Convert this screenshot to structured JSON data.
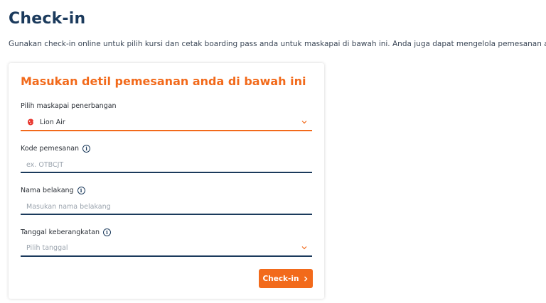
{
  "header": {
    "title": "Check-in",
    "description": "Gunakan check-in online untuk pilih kursi dan cetak boarding pass anda untuk maskapai di bawah ini. Anda juga dapat mengelola pemesanan anda."
  },
  "form": {
    "title": "Masukan detil pemesanan anda di bawah ini",
    "airline": {
      "label": "Pilih maskapai penerbangan",
      "selected_value": "Lion Air",
      "icon": "lion-air-logo"
    },
    "booking_code": {
      "label": "Kode pemesanan",
      "placeholder": "ex. OTBCJT",
      "value": ""
    },
    "last_name": {
      "label": "Nama belakang",
      "placeholder": "Masukan nama belakang",
      "value": ""
    },
    "departure_date": {
      "label": "Tanggal keberangkatan",
      "placeholder": "Pilih tanggal"
    },
    "submit_label": "Check-in"
  },
  "colors": {
    "accent": "#f26a1b",
    "navy": "#1b3a5c",
    "placeholder": "#9aa3ad"
  }
}
